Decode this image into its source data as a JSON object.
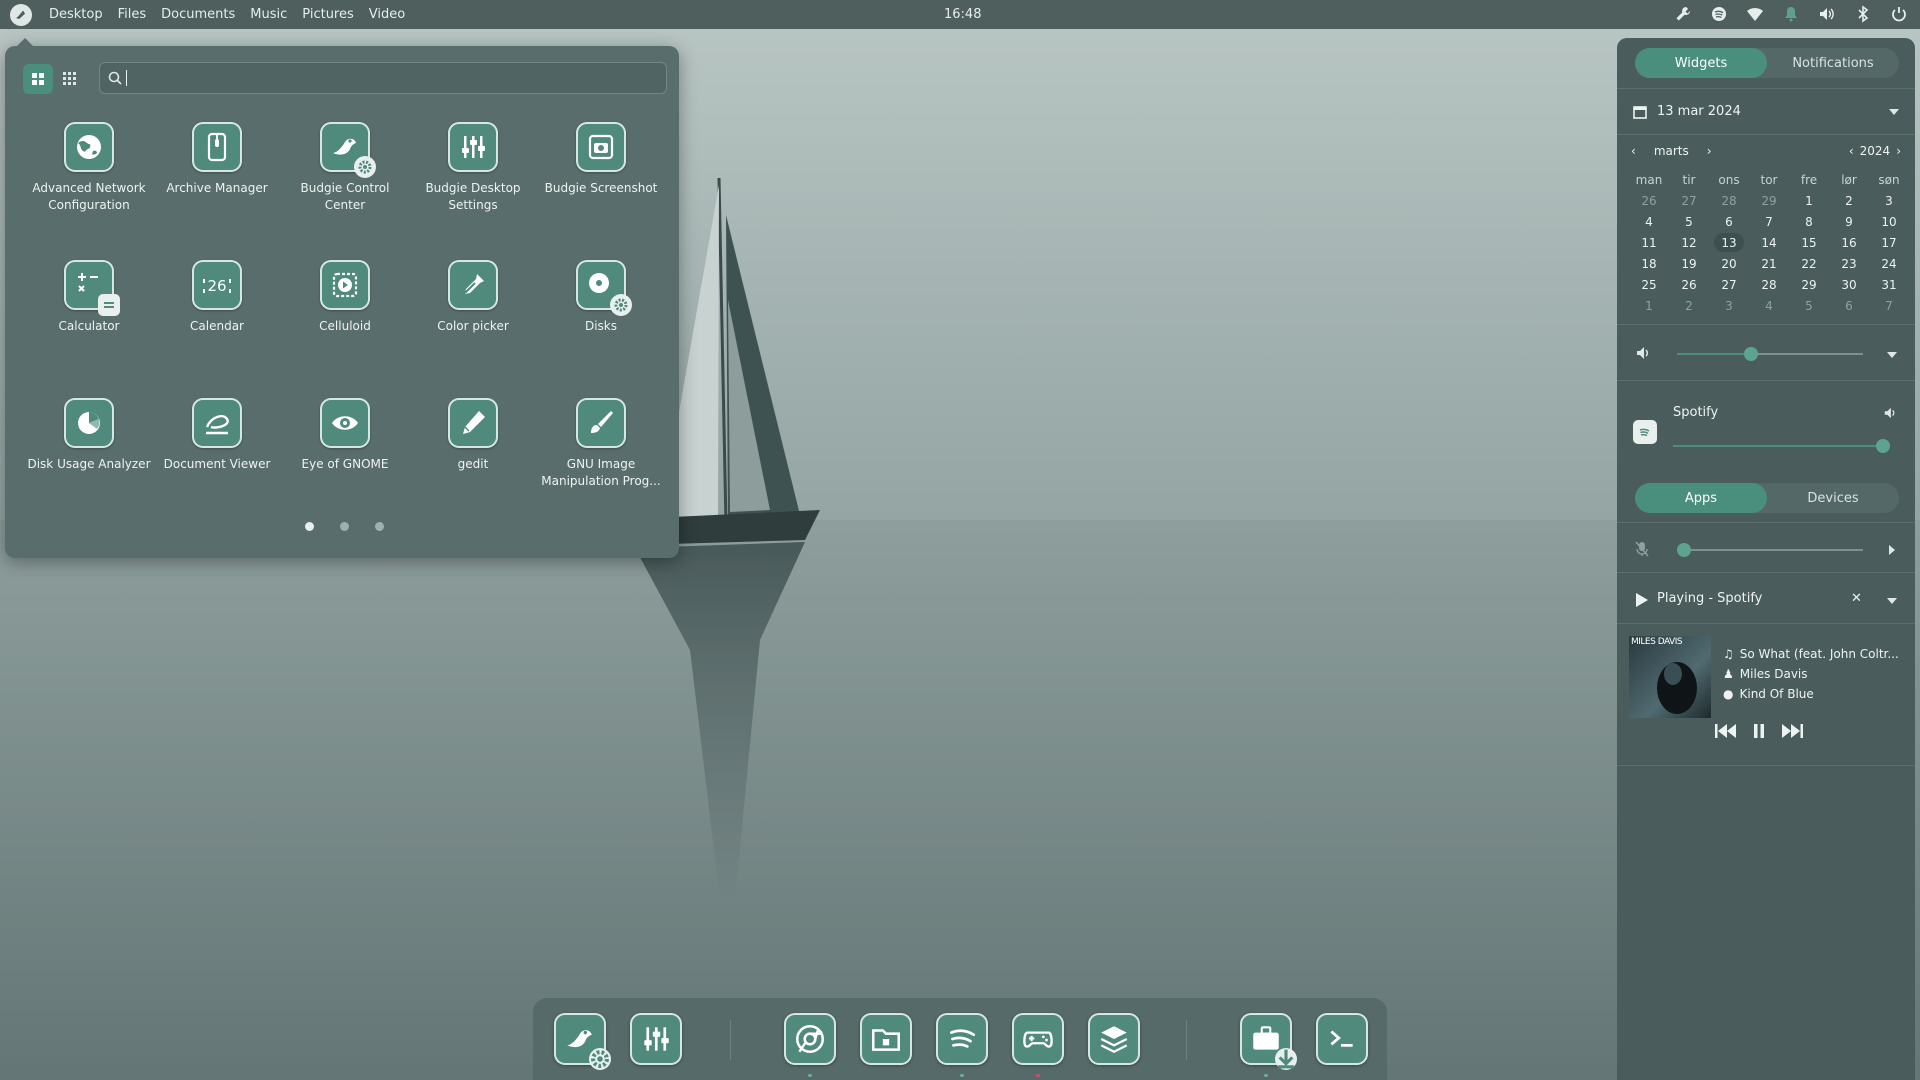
{
  "topbar": {
    "menu": [
      "Desktop",
      "Files",
      "Documents",
      "Music",
      "Pictures",
      "Video"
    ],
    "clock": "16:48",
    "tray_icons": [
      "settings-wrench-icon",
      "spotify-icon",
      "wifi-icon",
      "notification-bell-icon",
      "volume-icon",
      "bluetooth-icon",
      "power-icon"
    ]
  },
  "app_menu": {
    "search": {
      "value": "",
      "placeholder": ""
    },
    "view_modes": [
      "grid-view-icon",
      "compact-grid-icon"
    ],
    "apps": [
      {
        "name": "Advanced Network Configuration",
        "icon": "network-globe-icon"
      },
      {
        "name": "Archive Manager",
        "icon": "archive-icon"
      },
      {
        "name": "Budgie Control Center",
        "icon": "budgie-bird-icon"
      },
      {
        "name": "Budgie Desktop Settings",
        "icon": "sliders-icon"
      },
      {
        "name": "Budgie Screenshot",
        "icon": "screenshot-camera-icon"
      },
      {
        "name": "Calculator",
        "icon": "calculator-icon"
      },
      {
        "name": "Calendar",
        "icon": "calendar-icon",
        "day": "26"
      },
      {
        "name": "Celluloid",
        "icon": "video-play-icon"
      },
      {
        "name": "Color picker",
        "icon": "eyedropper-icon"
      },
      {
        "name": "Disks",
        "icon": "disk-icon"
      },
      {
        "name": "Disk Usage Analyzer",
        "icon": "pie-chart-icon"
      },
      {
        "name": "Document Viewer",
        "icon": "document-viewer-icon"
      },
      {
        "name": "Eye of GNOME",
        "icon": "eye-icon"
      },
      {
        "name": "gedit",
        "icon": "pencil-icon"
      },
      {
        "name": "GNU Image Manipulation Prog...",
        "icon": "brush-icon"
      }
    ],
    "pages": 3,
    "current_page": 1
  },
  "raven": {
    "tabs": [
      {
        "label": "Widgets",
        "active": true
      },
      {
        "label": "Notifications",
        "active": false
      }
    ],
    "date_header": "13 mar 2024",
    "calendar": {
      "month": "marts",
      "year": "2024",
      "weekdays": [
        "man",
        "tir",
        "ons",
        "tor",
        "fre",
        "lør",
        "søn"
      ],
      "weeks": [
        [
          "26",
          "27",
          "28",
          "29",
          "1",
          "2",
          "3"
        ],
        [
          "4",
          "5",
          "6",
          "7",
          "8",
          "9",
          "10"
        ],
        [
          "11",
          "12",
          "13",
          "14",
          "15",
          "16",
          "17"
        ],
        [
          "18",
          "19",
          "20",
          "21",
          "22",
          "23",
          "24"
        ],
        [
          "25",
          "26",
          "27",
          "28",
          "29",
          "30",
          "31"
        ],
        [
          "1",
          "2",
          "3",
          "4",
          "5",
          "6",
          "7"
        ]
      ],
      "today": "13"
    },
    "volume_level": 0.4,
    "app_volume": {
      "app": "Spotify",
      "level": 1.0
    },
    "audio_tabs": [
      {
        "label": "Apps",
        "active": true
      },
      {
        "label": "Devices",
        "active": false
      }
    ],
    "mic_level": 0.0,
    "player": {
      "status": "Playing - Spotify",
      "track": "So What (feat. John Coltr...",
      "artist": "Miles Davis",
      "album": "Kind Of Blue",
      "album_art_text": "MILES DAVIS"
    }
  },
  "dock": {
    "items": [
      "budgie-control-center",
      "budgie-desktop-settings",
      "chrome",
      "files",
      "spotify",
      "games",
      "stacks",
      "software-installer",
      "terminal"
    ]
  },
  "colors": {
    "accent": "#4a8f7d",
    "panel": "#4a5d5c",
    "topbar": "#4e5f5e"
  }
}
